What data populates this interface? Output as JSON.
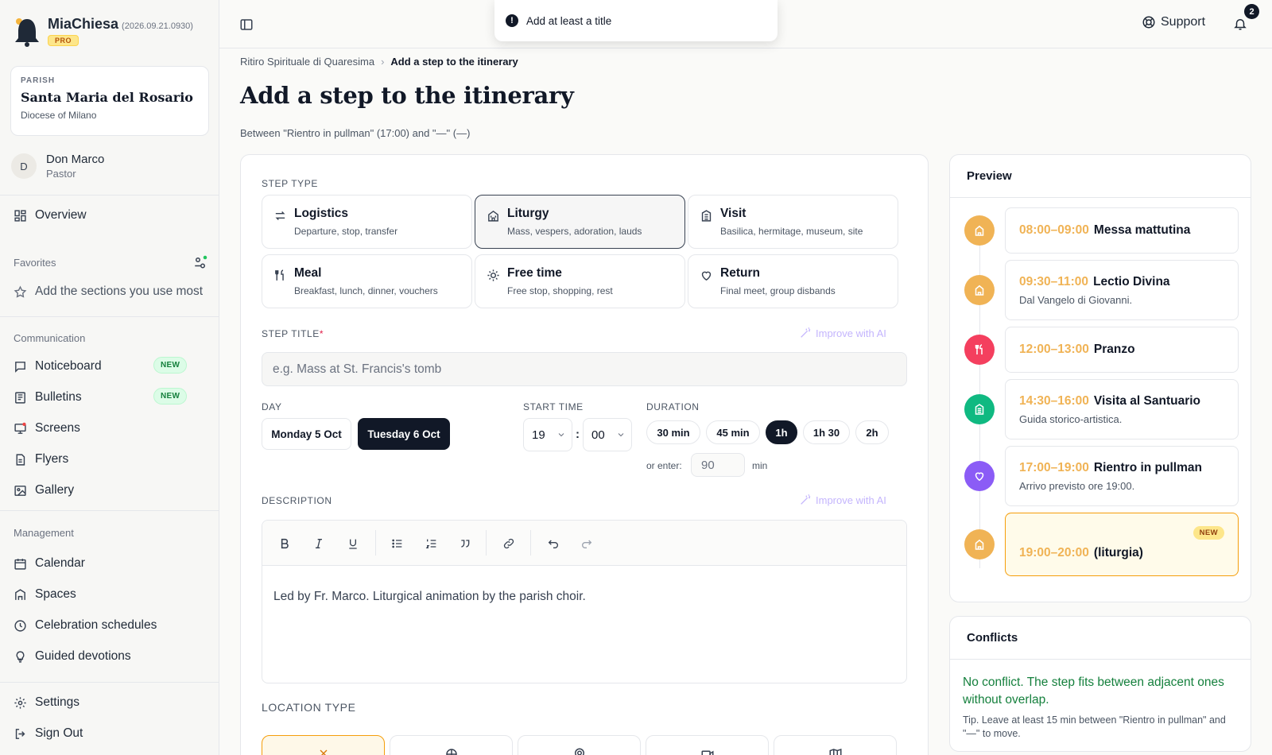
{
  "app": {
    "name": "MiaChiesa",
    "version": "(2026.09.21.0930)",
    "plan_badge": "PRO"
  },
  "parish": {
    "kicker": "PARISH",
    "name": "Santa Maria del Rosario",
    "diocese": "Diocese of Milano"
  },
  "user": {
    "initial": "D",
    "name": "Don Marco",
    "role": "Pastor"
  },
  "nav": {
    "overview": "Overview",
    "favorites_head": "Favorites",
    "favorites_hint": "Add the sections you use most",
    "communication_head": "Communication",
    "noticeboard": "Noticeboard",
    "bulletins": "Bulletins",
    "new_badge": "NEW",
    "screens": "Screens",
    "flyers": "Flyers",
    "gallery": "Gallery",
    "management_head": "Management",
    "calendar": "Calendar",
    "spaces": "Spaces",
    "celebration_schedules": "Celebration schedules",
    "guided_devotions": "Guided devotions",
    "settings": "Settings",
    "sign_out": "Sign Out"
  },
  "topbar": {
    "toast": "Add at least a title",
    "support": "Support",
    "notification_count": "2"
  },
  "breadcrumb": {
    "parent": "Ritiro Spirituale di Quaresima",
    "current": "Add a step to the itinerary"
  },
  "page": {
    "title": "Add a step to the itinerary",
    "subtitle": "Between \"Rientro in pullman\" (17:00) and \"—\" (—)"
  },
  "form": {
    "step_type_label": "STEP TYPE",
    "types": [
      {
        "title": "Logistics",
        "desc": "Departure, stop, transfer"
      },
      {
        "title": "Liturgy",
        "desc": "Mass, vespers, adoration, lauds"
      },
      {
        "title": "Visit",
        "desc": "Basilica, hermitage, museum, site"
      },
      {
        "title": "Meal",
        "desc": "Breakfast, lunch, dinner, vouchers"
      },
      {
        "title": "Free time",
        "desc": "Free stop, shopping, rest"
      },
      {
        "title": "Return",
        "desc": "Final meet, group disbands"
      }
    ],
    "selected_type": "Liturgy",
    "title_label": "STEP TITLE",
    "required_mark": "*",
    "improve_ai": "Improve with AI",
    "title_placeholder": "e.g. Mass at St. Francis's tomb",
    "title_value": "",
    "day_label": "DAY",
    "days": [
      "Monday 5 Oct",
      "Tuesday 6 Oct"
    ],
    "selected_day": "Tuesday 6 Oct",
    "start_time_label": "START TIME",
    "hour": "19",
    "time_sep": ":",
    "minute": "00",
    "duration_label": "DURATION",
    "durations": [
      "30 min",
      "45 min",
      "1h",
      "1h 30",
      "2h"
    ],
    "selected_duration": "1h",
    "or_enter": "or enter:",
    "duration_value": "90",
    "min_unit": "min",
    "description_label": "DESCRIPTION",
    "description_text": "Led by Fr. Marco. Liturgical animation by the parish choir.",
    "location_type_label": "LOCATION TYPE"
  },
  "preview": {
    "title": "Preview",
    "items": [
      {
        "time": "08:00–09:00",
        "name": "Messa mattutina",
        "note": "",
        "kind": "liturgy",
        "color": "#f0b355"
      },
      {
        "time": "09:30–11:00",
        "name": "Lectio Divina",
        "note": "Dal Vangelo di Giovanni.",
        "kind": "liturgy",
        "color": "#f0b355"
      },
      {
        "time": "12:00–13:00",
        "name": "Pranzo",
        "note": "",
        "kind": "meal",
        "color": "#f43f5e"
      },
      {
        "time": "14:30–16:00",
        "name": "Visita al Santuario",
        "note": "Guida storico-artistica.",
        "kind": "visit",
        "color": "#10b981"
      },
      {
        "time": "17:00–19:00",
        "name": "Rientro in pullman",
        "note": "Arrivo previsto ore 19:00.",
        "kind": "return",
        "color": "#8b5cf6"
      },
      {
        "time": "19:00–20:00",
        "name": "(liturgia)",
        "note": "",
        "kind": "liturgy",
        "color": "#f0b355",
        "badge": "NEW"
      }
    ]
  },
  "conflicts": {
    "title": "Conflicts",
    "status": "No conflict. The step fits between adjacent ones without overlap.",
    "tip": "Tip. Leave at least 15 min between \"Rientro in pullman\" and \"—\" to move."
  },
  "colors": {
    "accent": "#f59e0b",
    "dark": "#111827",
    "success": "#15803d",
    "ai": "#c4b5fd"
  }
}
